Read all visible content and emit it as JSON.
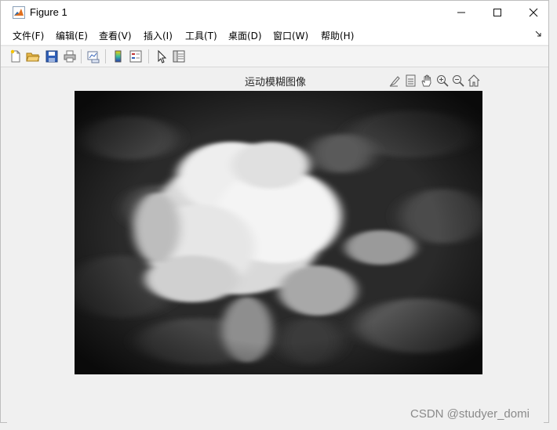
{
  "window": {
    "title": "Figure 1",
    "controls": {
      "minimize": "minimize-icon",
      "maximize": "maximize-icon",
      "close": "close-icon"
    }
  },
  "menu": [
    {
      "label": "文件(F)"
    },
    {
      "label": "编辑(E)"
    },
    {
      "label": "查看(V)"
    },
    {
      "label": "插入(I)"
    },
    {
      "label": "工具(T)"
    },
    {
      "label": "桌面(D)"
    },
    {
      "label": "窗口(W)"
    },
    {
      "label": "帮助(H)"
    }
  ],
  "toolbar": [
    "new-figure-icon",
    "open-file-icon",
    "save-icon",
    "print-icon",
    "link-plot-icon",
    "colorbar-icon",
    "legend-icon",
    "edit-plot-icon",
    "property-inspector-icon"
  ],
  "axes": {
    "title": "运动模糊图像",
    "tools": [
      "brush-icon",
      "data-tips-icon",
      "pan-icon",
      "zoom-in-icon",
      "zoom-out-icon",
      "home-icon"
    ]
  },
  "image": {
    "description_icon": "grayscale-image"
  },
  "watermark": "CSDN @studyer_domi",
  "colors": {
    "window_bg": "#f0f0f0",
    "titlebar_bg": "#ffffff"
  }
}
